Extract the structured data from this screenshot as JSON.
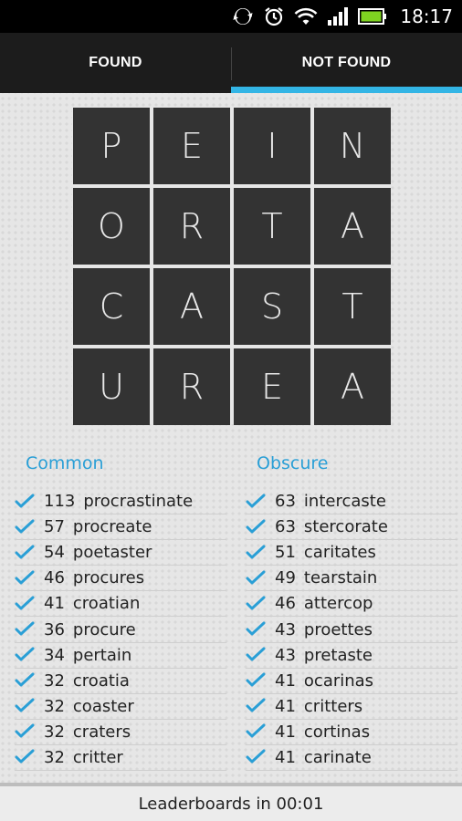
{
  "status": {
    "time": "18:17"
  },
  "tabs": [
    {
      "label": "FOUND",
      "active": false
    },
    {
      "label": "NOT FOUND",
      "active": true
    }
  ],
  "grid": [
    "P",
    "E",
    "I",
    "N",
    "O",
    "R",
    "T",
    "A",
    "C",
    "A",
    "S",
    "T",
    "U",
    "R",
    "E",
    "A"
  ],
  "common": {
    "heading": "Common",
    "items": [
      {
        "score": "113",
        "word": "procrastinate"
      },
      {
        "score": "57",
        "word": "procreate"
      },
      {
        "score": "54",
        "word": "poetaster"
      },
      {
        "score": "46",
        "word": "procures"
      },
      {
        "score": "41",
        "word": "croatian"
      },
      {
        "score": "36",
        "word": "procure"
      },
      {
        "score": "34",
        "word": "pertain"
      },
      {
        "score": "32",
        "word": "croatia"
      },
      {
        "score": "32",
        "word": "coaster"
      },
      {
        "score": "32",
        "word": "craters"
      },
      {
        "score": "32",
        "word": "critter"
      }
    ]
  },
  "obscure": {
    "heading": "Obscure",
    "items": [
      {
        "score": "63",
        "word": "intercaste"
      },
      {
        "score": "63",
        "word": "stercorate"
      },
      {
        "score": "51",
        "word": "caritates"
      },
      {
        "score": "49",
        "word": "tearstain"
      },
      {
        "score": "46",
        "word": "attercop"
      },
      {
        "score": "43",
        "word": "proettes"
      },
      {
        "score": "43",
        "word": "pretaste"
      },
      {
        "score": "41",
        "word": "ocarinas"
      },
      {
        "score": "41",
        "word": "critters"
      },
      {
        "score": "41",
        "word": "cortinas"
      },
      {
        "score": "41",
        "word": "carinate"
      }
    ]
  },
  "footer": {
    "text": "Leaderboards in 00:01"
  },
  "colors": {
    "accent": "#33b5e5",
    "heading": "#2a9fd6",
    "tile": "#333333",
    "check": "#2a9fd6"
  },
  "icons": [
    "sync-icon",
    "alarm-icon",
    "wifi-icon",
    "signal-icon",
    "battery-icon",
    "check-icon"
  ]
}
